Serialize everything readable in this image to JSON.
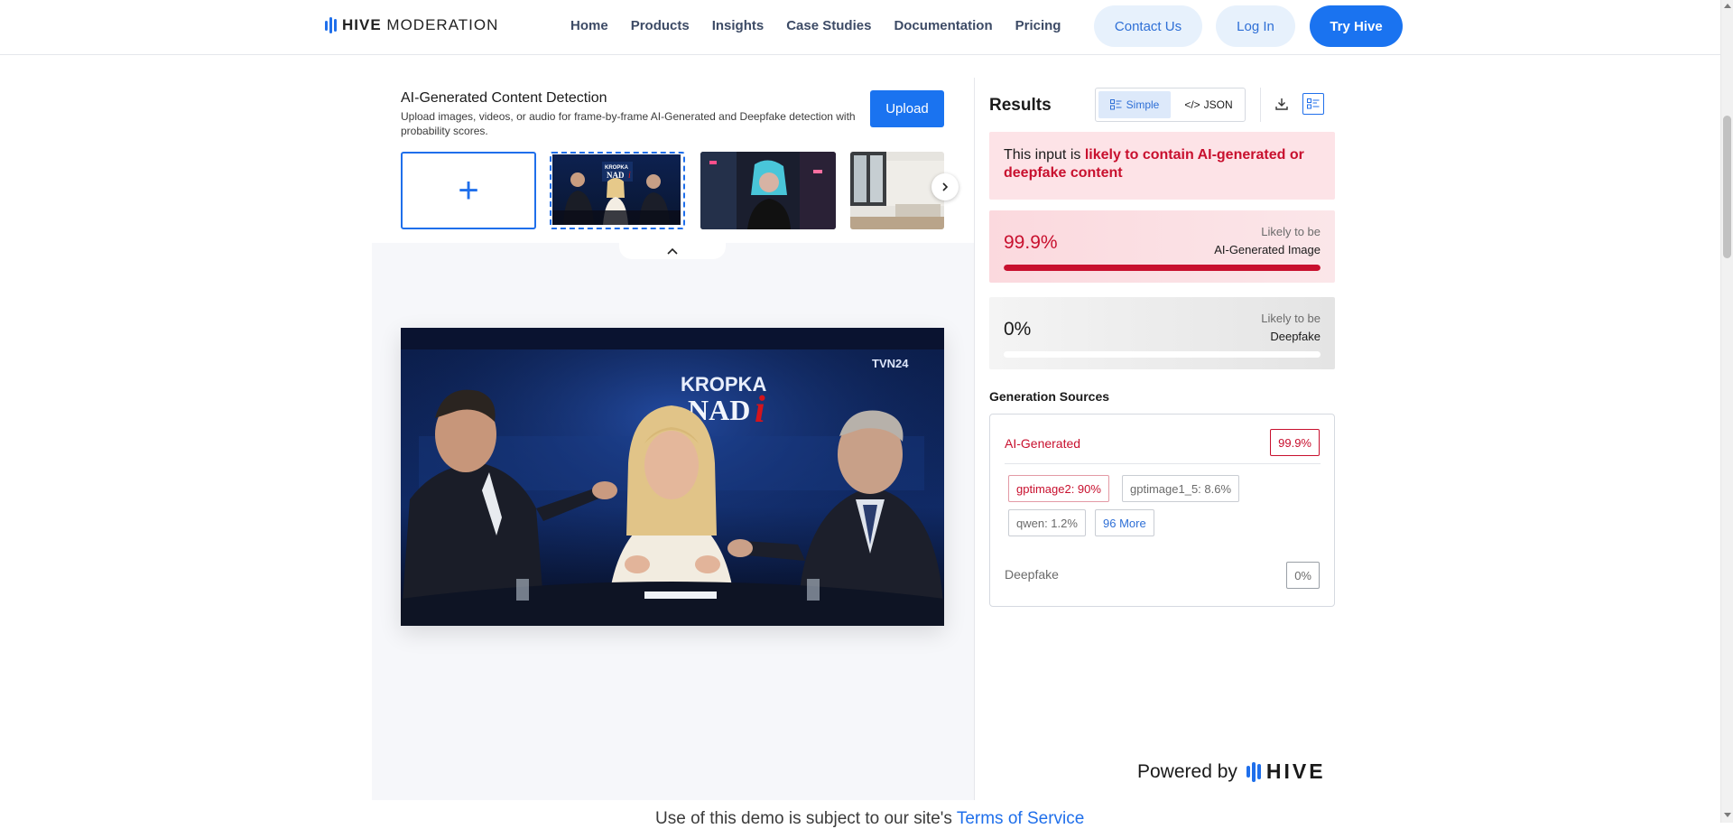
{
  "header": {
    "brand_bold": "HIVE",
    "brand_light": "MODERATION",
    "nav": [
      "Home",
      "Products",
      "Insights",
      "Case Studies",
      "Documentation",
      "Pricing"
    ],
    "contact": "Contact Us",
    "login": "Log In",
    "try": "Try Hive"
  },
  "detector": {
    "title": "AI-Generated Content Detection",
    "subtitle": "Upload images, videos, or audio for frame-by-frame AI-Generated and Deepfake detection with probability scores.",
    "upload": "Upload",
    "add_symbol": "+"
  },
  "results": {
    "title": "Results",
    "simple": "Simple",
    "json": "JSON",
    "verdict_prefix": "This input is ",
    "verdict_highlight": "likely to contain AI-generated or deepfake content",
    "ai": {
      "value": "99.9%",
      "cap1": "Likely to be",
      "cap2": "AI-Generated Image",
      "fraction": 0.999
    },
    "deepfake": {
      "value": "0%",
      "cap1": "Likely to be",
      "cap2": "Deepfake",
      "fraction": 0.0
    },
    "gen_title": "Generation Sources",
    "gen_ai_label": "AI-Generated",
    "gen_ai_value": "99.9%",
    "chips": [
      "gptimage2: 90%",
      "gptimage1_5: 8.6%",
      "qwen: 1.2%",
      "96 More"
    ],
    "gen_df_label": "Deepfake",
    "gen_df_value": "0%",
    "powered_by": "Powered by",
    "powered_brand": "HIVE"
  },
  "footer": {
    "text": "Use of this demo is subject to our site's ",
    "link": "Terms of Service"
  },
  "colors": {
    "accent": "#1a73f0",
    "danger": "#c8102e",
    "verdict_bg": "#fde3e7"
  }
}
